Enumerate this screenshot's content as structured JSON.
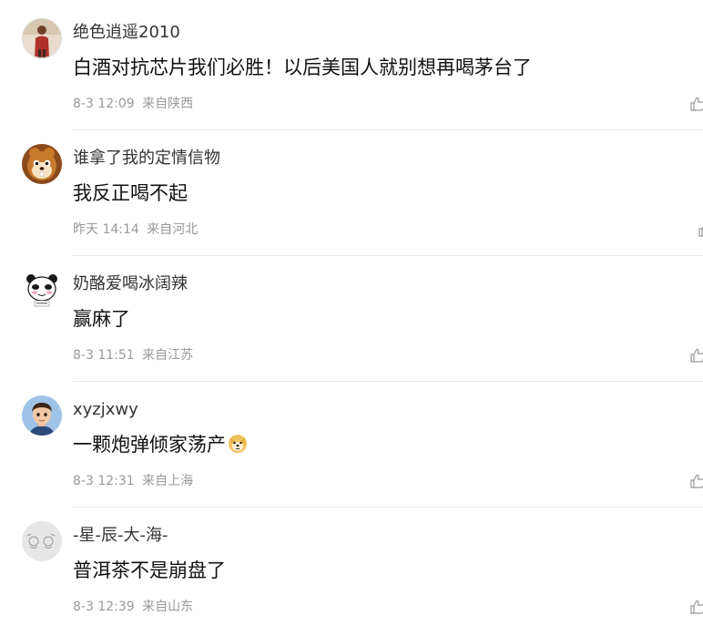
{
  "comments": [
    {
      "username": "绝色逍遥2010",
      "content": "白酒对抗芯片我们必胜！以后美国人就别想再喝茅台了",
      "time": "8-3 12:09",
      "location": "来自陕西",
      "avatar_icon": "person-red-shirt-avatar"
    },
    {
      "username": "谁拿了我的定情信物",
      "content": "我反正喝不起",
      "time": "昨天 14:14",
      "location": "来自河北",
      "avatar_icon": "cartoon-chipmunk-avatar"
    },
    {
      "username": "奶酪爱喝冰阔辣",
      "content": "赢麻了",
      "time": "8-3 11:51",
      "location": "来自江苏",
      "avatar_icon": "panda-meme-avatar"
    },
    {
      "username": "xyzjxwy",
      "content": "一颗炮弹倾家荡产",
      "time": "8-3 12:31",
      "location": "来自上海",
      "avatar_icon": "3d-cartoon-boy-avatar",
      "emoji_icon": "doge-emoji"
    },
    {
      "username": "-星-辰-大-海-",
      "content": "普洱茶不是崩盘了",
      "time": "8-3 12:39",
      "location": "来自山东",
      "avatar_icon": "hand-drawn-sketch-avatar"
    }
  ],
  "colors": {
    "username": "#333333",
    "content": "#111111",
    "meta": "#999999",
    "divider": "#e8e8e8"
  }
}
